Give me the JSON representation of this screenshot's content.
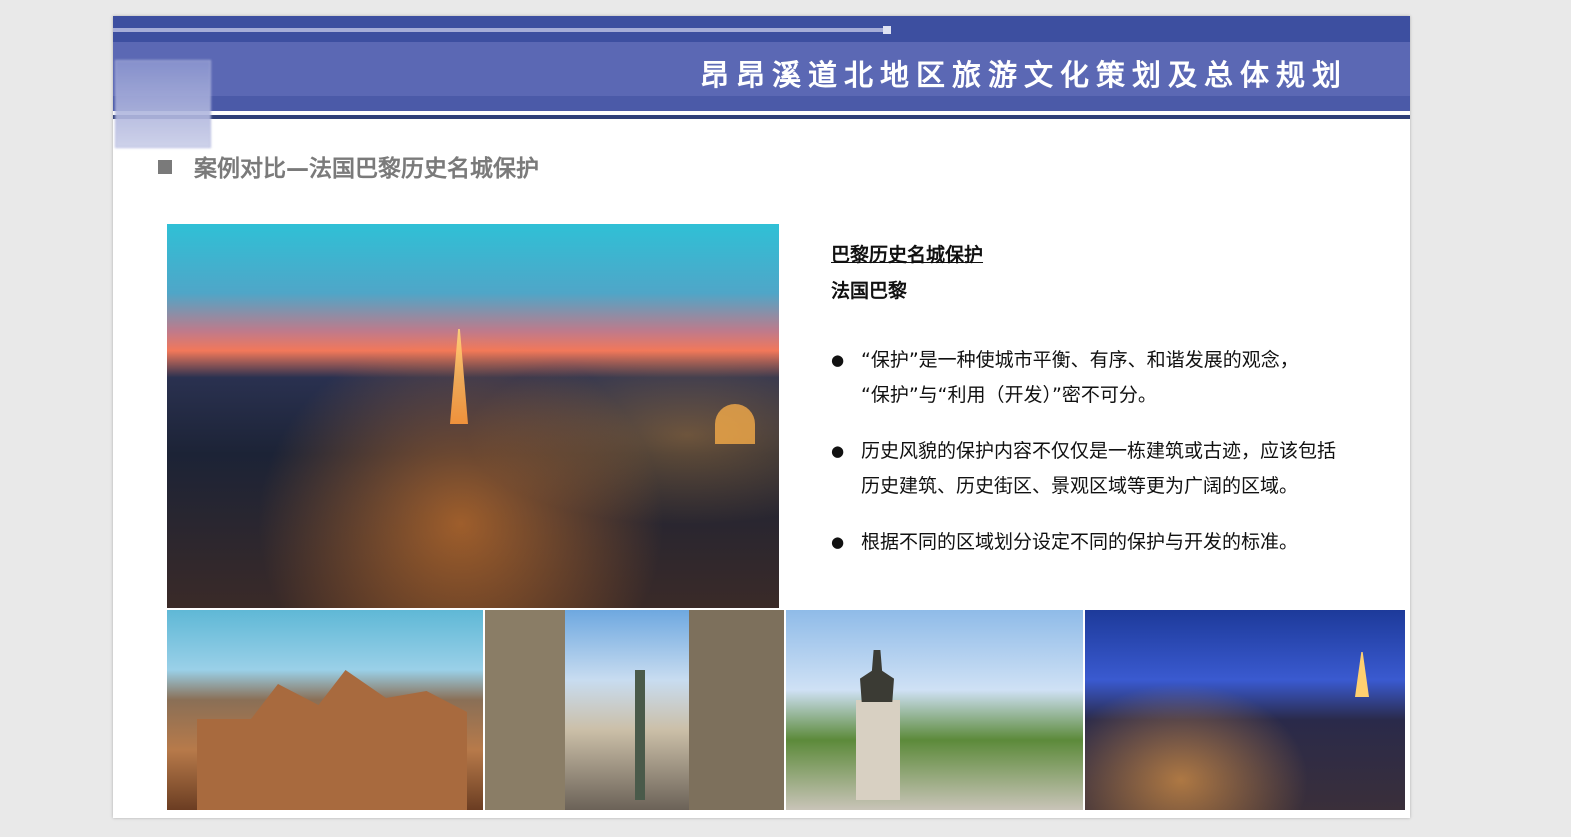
{
  "header": {
    "title": "昂昂溪道北地区旅游文化策划及总体规划"
  },
  "section": {
    "title": "案例对比—法国巴黎历史名城保护"
  },
  "content": {
    "heading": "巴黎历史名城保护",
    "subheading": "法国巴黎",
    "bullets": [
      {
        "line1": "“保护”是一种使城市平衡、有序、和谐发展的观念，",
        "line2": "“保护”与“利用（开发）”密不可分。"
      },
      {
        "line1": "历史风貌的保护内容不仅仅是一栋建筑或古迹，应该包括",
        "line2": "历史建筑、历史街区、景观区域等更为广阔的区域。"
      },
      {
        "line1": "根据不同的区域划分设定不同的保护与开发的标准。",
        "line2": ""
      }
    ]
  },
  "colors": {
    "header_primary": "#5b68b4",
    "header_dark": "#3d4fa0",
    "section_title": "#7a7a7a"
  }
}
